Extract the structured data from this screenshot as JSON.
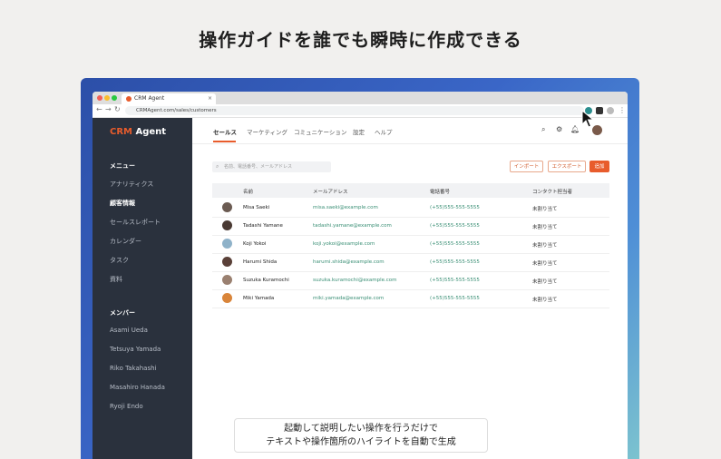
{
  "headline": "操作ガイドを誰でも瞬時に作成できる",
  "browser": {
    "tab_title": "CRM Agent",
    "tab_close": "×",
    "url": "CRMAgent.com/sales/customers",
    "nav_back": "←",
    "nav_forward": "→",
    "nav_reload": "↻"
  },
  "app": {
    "logo_part1": "CRM",
    "logo_part2": " Agent",
    "sidebar": {
      "menu_header": "メニュー",
      "menu_items": [
        "アナリティクス",
        "顧客情報",
        "セールスレポート",
        "カレンダー",
        "タスク",
        "資料"
      ],
      "members_header": "メンバー",
      "members": [
        "Asami Ueda",
        "Tetsuya Yamada",
        "Riko Takahashi",
        "Masahiro Hanada",
        "Ryoji Endo"
      ]
    },
    "topnav": [
      "セールス",
      "マーケティング",
      "コミュニケーション",
      "設定",
      "ヘルプ"
    ],
    "search_placeholder": "名前、電話番号、メールアドレス",
    "buttons": {
      "import": "インポート",
      "export": "エクスポート",
      "add": "追加"
    },
    "table": {
      "headers": [
        "名前",
        "メールアドレス",
        "電話番号",
        "コンタクト担当者"
      ],
      "rows": [
        {
          "name": "Misa Saeki",
          "email": "misa.saeki@example.com",
          "phone": "(+55)555-555-5555",
          "assignee": "未割り当て"
        },
        {
          "name": "Tadashi Yamane",
          "email": "tadashi.yamane@example.com",
          "phone": "(+55)555-555-5555",
          "assignee": "未割り当て"
        },
        {
          "name": "Koji Yokoi",
          "email": "koji.yokoi@example.com",
          "phone": "(+55)555-555-5555",
          "assignee": "未割り当て"
        },
        {
          "name": "Harumi Shida",
          "email": "harumi.shida@example.com",
          "phone": "(+55)555-555-5555",
          "assignee": "未割り当て"
        },
        {
          "name": "Suzuka Kuramochi",
          "email": "suzuka.kuramochi@example.com",
          "phone": "(+55)555-555-5555",
          "assignee": "未割り当て"
        },
        {
          "name": "Miki Yamada",
          "email": "miki.yamada@example.com",
          "phone": "(+55)555-555-5555",
          "assignee": "未割り当て"
        }
      ]
    }
  },
  "caption": {
    "line1": "起動して説明したい操作を行うだけで",
    "line2": "テキストや操作箇所のハイライトを自動で生成"
  },
  "colors": {
    "accent": "#e85c2c",
    "sidebar": "#2a313d",
    "link": "#3a8f75"
  }
}
